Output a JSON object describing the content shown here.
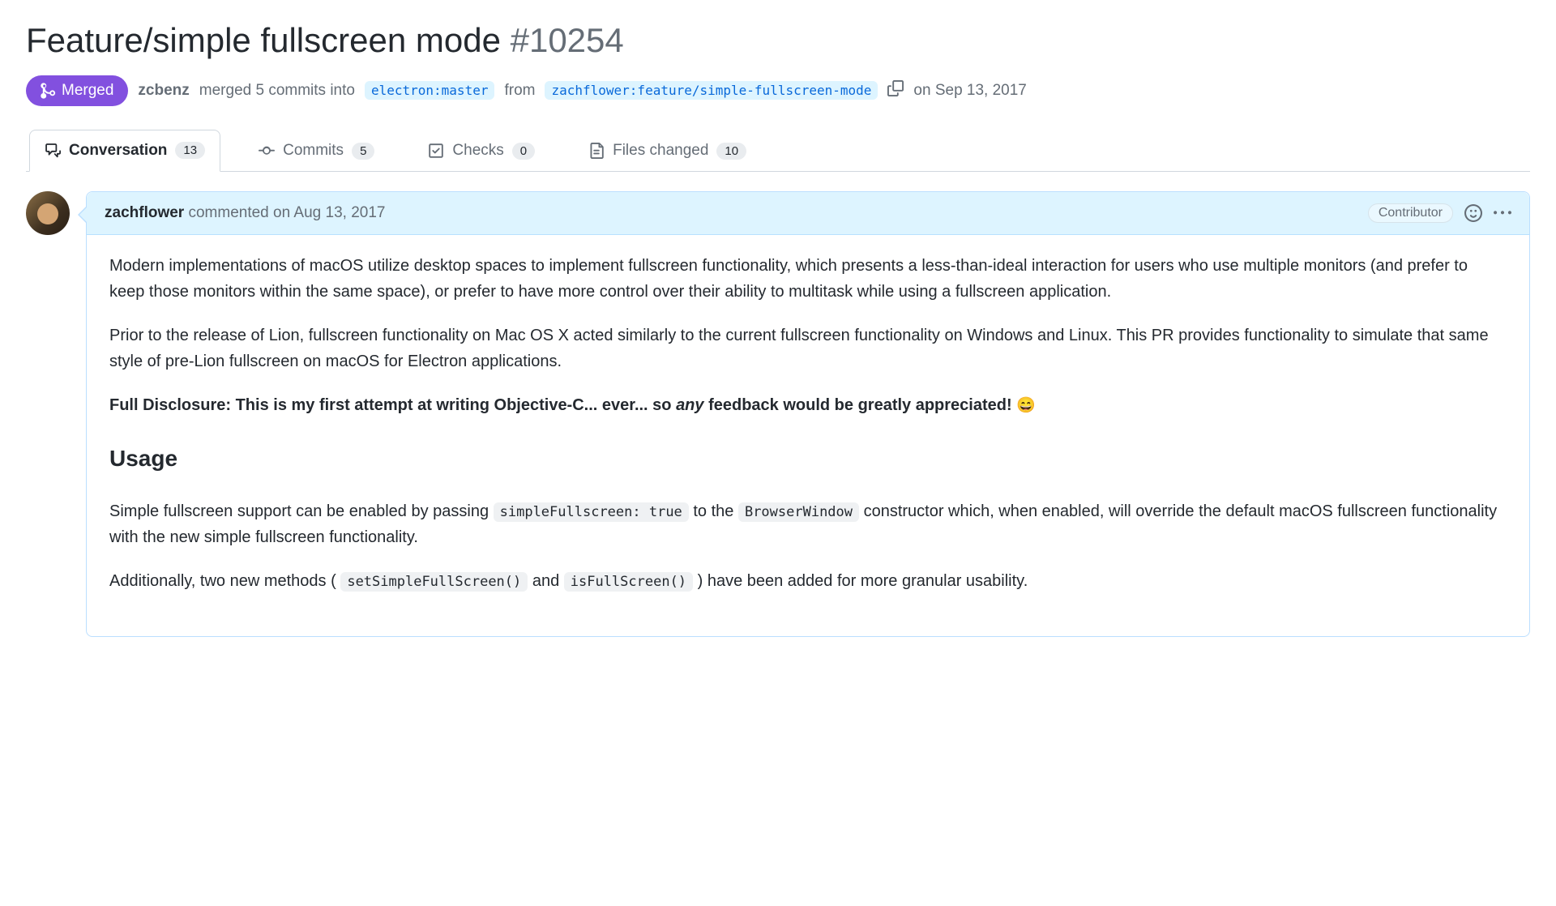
{
  "title": "Feature/simple fullscreen mode",
  "issue_number": "#10254",
  "state": {
    "label": "Merged"
  },
  "merge_meta": {
    "merger": "zcbenz",
    "action_prefix": "merged 5 commits into",
    "base_branch": "electron:master",
    "middle": "from",
    "head_branch": "zachflower:feature/simple-fullscreen-mode",
    "date": "on Sep 13, 2017"
  },
  "tabs": {
    "conversation": {
      "label": "Conversation",
      "count": "13"
    },
    "commits": {
      "label": "Commits",
      "count": "5"
    },
    "checks": {
      "label": "Checks",
      "count": "0"
    },
    "files": {
      "label": "Files changed",
      "count": "10"
    }
  },
  "comment": {
    "author": "zachflower",
    "verb": "commented",
    "date": "on Aug 13, 2017",
    "role": "Contributor",
    "body": {
      "p1": "Modern implementations of macOS utilize desktop spaces to implement fullscreen functionality, which presents a less-than-ideal interaction for users who use multiple monitors (and prefer to keep those monitors within the same space), or prefer to have more control over their ability to multitask while using a fullscreen application.",
      "p2": "Prior to the release of Lion, fullscreen functionality on Mac OS X acted similarly to the current fullscreen functionality on Windows and Linux. This PR provides functionality to simulate that same style of pre-Lion fullscreen on macOS for Electron applications.",
      "p3_strong_pre": "Full Disclosure: This is my first attempt at writing Objective-C... ever... so ",
      "p3_em": "any",
      "p3_strong_post": " feedback would be greatly appreciated!",
      "p3_emoji": "😄",
      "h_usage": "Usage",
      "p4_pre": "Simple fullscreen support can be enabled by passing ",
      "p4_code1": "simpleFullscreen: true",
      "p4_mid1": " to the ",
      "p4_code2": "BrowserWindow",
      "p4_post": " constructor which, when enabled, will override the default macOS fullscreen functionality with the new simple fullscreen functionality.",
      "p5_pre": "Additionally, two new methods ( ",
      "p5_code1": "setSimpleFullScreen()",
      "p5_mid": " and ",
      "p5_code2": "isFullScreen()",
      "p5_post": " ) have been added for more granular usability."
    }
  }
}
